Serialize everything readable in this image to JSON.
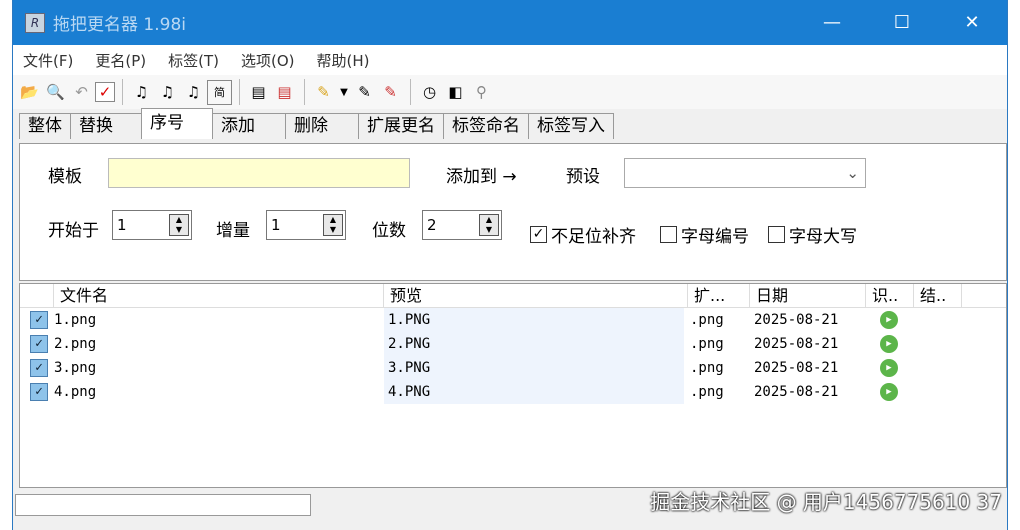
{
  "title": "拖把更名器 1.98i",
  "menu": [
    "文件(F)",
    "更名(P)",
    "标签(T)",
    "选项(O)",
    "帮助(H)"
  ],
  "tabs": [
    "整体",
    "替换",
    "序号",
    "添加",
    "删除",
    "扩展更名",
    "标签命名",
    "标签写入"
  ],
  "panel": {
    "template_label": "模板",
    "template_value": "",
    "add_to_label": "添加到 →",
    "preset_label": "预设",
    "preset_value": "",
    "start_label": "开始于",
    "start_value": "1",
    "inc_label": "增量",
    "inc_value": "1",
    "digits_label": "位数",
    "digits_value": "2",
    "pad_label": "不足位补齐",
    "letter_num_label": "字母编号",
    "upper_label": "字母大写"
  },
  "columns": [
    "文件名",
    "预览",
    "扩...",
    "日期",
    "识..",
    "结.."
  ],
  "rows": [
    {
      "name": "1.png",
      "preview": "1.PNG",
      "ext": ".png",
      "date": "2025-08-21"
    },
    {
      "name": "2.png",
      "preview": "2.PNG",
      "ext": ".png",
      "date": "2025-08-21"
    },
    {
      "name": "3.png",
      "preview": "3.PNG",
      "ext": ".png",
      "date": "2025-08-21"
    },
    {
      "name": "4.png",
      "preview": "4.PNG",
      "ext": ".png",
      "date": "2025-08-21"
    }
  ],
  "watermark": "掘金技术社区 @ 用户1456775610 37"
}
